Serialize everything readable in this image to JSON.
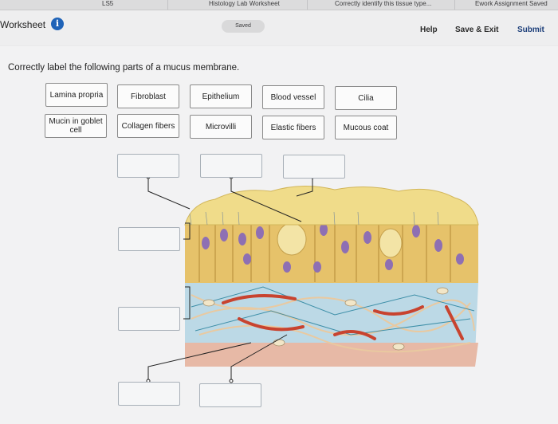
{
  "browser_bar": {
    "tabs": [
      "LS5",
      "Histology Lab Worksheet",
      "Correctly identify this tissue type...",
      "Ework Assignment Saved"
    ]
  },
  "header": {
    "title": "Worksheet",
    "info_icon": "info-icon",
    "saved_status": "Saved",
    "help_label": "Help",
    "save_exit_label": "Save & Exit",
    "submit_label": "Submit"
  },
  "question": {
    "prompt": "Correctly label the following parts of a mucus membrane."
  },
  "labels": [
    {
      "text": "Lamina propria"
    },
    {
      "text": "Fibroblast"
    },
    {
      "text": "Epithelium"
    },
    {
      "text": "Blood vessel"
    },
    {
      "text": "Cilia"
    },
    {
      "text": "Mucin in goblet cell"
    },
    {
      "text": "Collagen fibers"
    },
    {
      "text": "Microvilli"
    },
    {
      "text": "Elastic fibers"
    },
    {
      "text": "Mucous coat"
    }
  ],
  "drop_targets": [
    {
      "value": ""
    },
    {
      "value": ""
    },
    {
      "value": ""
    },
    {
      "value": ""
    },
    {
      "value": ""
    },
    {
      "value": ""
    },
    {
      "value": ""
    }
  ],
  "colors": {
    "accent": "#1f63b8",
    "epithelium": "#e6c26a",
    "nucleus": "#8e6fb3",
    "mucus": "#f0dc8a",
    "connective": "#bcd9e6",
    "vessel": "#c8432f"
  }
}
